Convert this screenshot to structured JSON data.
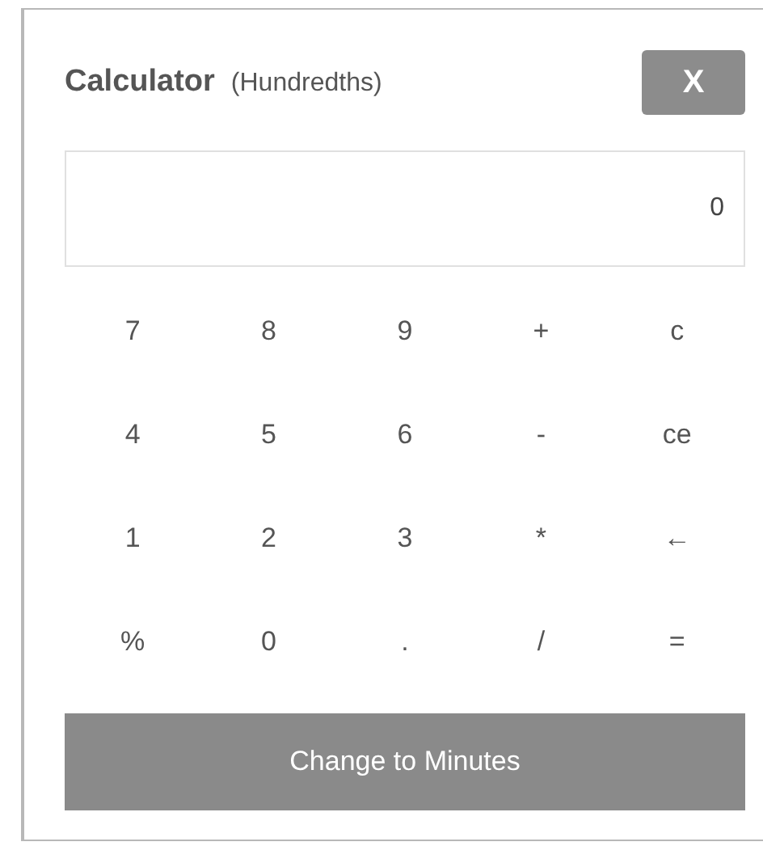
{
  "title": "Calculator",
  "subtitle": "(Hundredths)",
  "close_button": "X",
  "display": {
    "value": "0"
  },
  "keys": [
    [
      "7",
      "8",
      "9",
      "+",
      "c"
    ],
    [
      "4",
      "5",
      "6",
      "-",
      "ce"
    ],
    [
      "1",
      "2",
      "3",
      "*",
      "←"
    ],
    [
      "%",
      "0",
      ".",
      "/",
      "="
    ]
  ],
  "action_button": "Change to Minutes"
}
